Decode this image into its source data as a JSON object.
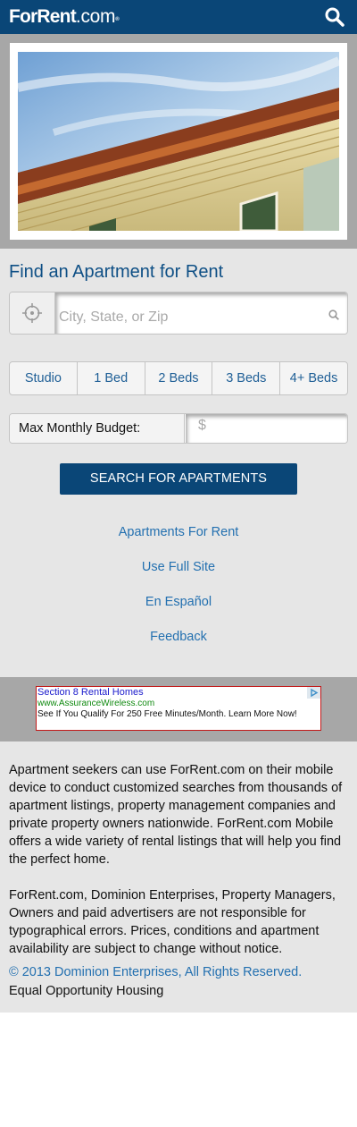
{
  "header": {
    "logo_main": "ForRent",
    "logo_suffix": ".com",
    "logo_mark": "®",
    "search_icon": "search-icon"
  },
  "search": {
    "title": "Find an Apartment for Rent",
    "location_placeholder": "City, State, or Zip",
    "location_value": "",
    "beds": [
      "Studio",
      "1 Bed",
      "2 Beds",
      "3 Beds",
      "4+ Beds"
    ],
    "budget_label": "Max Monthly Budget:",
    "budget_placeholder": "$",
    "submit_label": "SEARCH FOR APARTMENTS"
  },
  "links": [
    "Apartments For Rent",
    "Use Full Site",
    "En Español",
    "Feedback"
  ],
  "ad": {
    "title": "Section 8 Rental Homes",
    "url": "www.AssuranceWireless.com",
    "text": "See If You Qualify For 250 Free Minutes/Month. Learn More Now!"
  },
  "about": {
    "p1": "Apartment seekers can use ForRent.com on their mobile device to conduct customized searches from thousands of apartment listings, property management companies and private property owners nationwide. ForRent.com Mobile offers a wide variety of rental listings that will help you find the perfect home.",
    "p2": "ForRent.com, Dominion Enterprises, Property Managers, Owners and paid advertisers are not responsible for typographical errors. Prices, conditions and apartment availability are subject to change without notice.",
    "copyright": "© 2013 Dominion Enterprises, All Rights Reserved.",
    "equal_housing": "Equal Opportunity Housing"
  },
  "colors": {
    "brand": "#0a4677",
    "link": "#2370b0",
    "background": "#e6e6e6",
    "ad_band": "#a7a7a7"
  }
}
